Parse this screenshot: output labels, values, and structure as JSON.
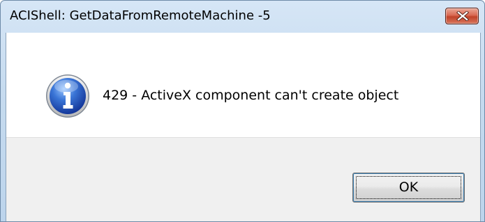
{
  "window": {
    "title": "ACIShell: GetDataFromRemoteMachine -5",
    "close_icon": "close-icon"
  },
  "dialog": {
    "icon": "info-icon",
    "message": "429 - ActiveX component can't create object",
    "ok_label": "OK"
  },
  "colors": {
    "close_button": "#d05a42",
    "titlebar": "#c6dbef",
    "button_area": "#f0f0f0",
    "info_icon": "#2f63c6"
  }
}
